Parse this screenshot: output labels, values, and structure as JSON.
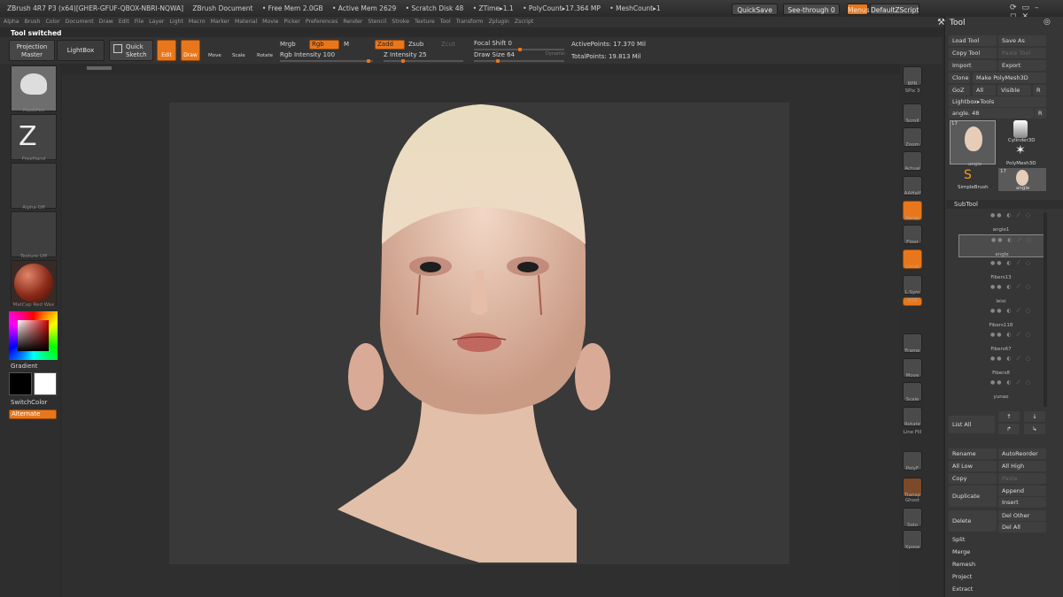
{
  "titlebar": {
    "app": "ZBrush 4R7 P3 (x64)[GHER-GFUF-QBOX-NBRI-NQWA]",
    "doc": "ZBrush Document",
    "free_mem": "• Free Mem 2.0GB",
    "active_mem": "• Active Mem 2629",
    "scratch": "• Scratch Disk 48",
    "ztime": "• ZTime▸1.1",
    "polycount": "• PolyCount▸17.364 MP",
    "meshcount": "• MeshCount▸1",
    "quicksave": "QuickSave",
    "seethrough": "See-through  0",
    "menus": "Menus",
    "script": "DefaultZScript"
  },
  "menus": [
    "Alpha",
    "Brush",
    "Color",
    "Document",
    "Draw",
    "Edit",
    "File",
    "Layer",
    "Light",
    "Macro",
    "Marker",
    "Material",
    "Movie",
    "Picker",
    "Preferences",
    "Render",
    "Stencil",
    "Stroke",
    "Texture",
    "Tool",
    "Transform",
    "Zplugin",
    "Zscript"
  ],
  "status": "Tool switched",
  "shelf": {
    "projection": "Projection Master",
    "lightbox": "LightBox",
    "quick": "Quick Sketch",
    "edit": "Edit",
    "draw": "Draw",
    "move": "Move",
    "scale": "Scale",
    "rotate": "Rotate",
    "mrgb": "Mrgb",
    "rgb": "Rgb",
    "m": "M",
    "zadd": "Zadd",
    "zsub": "Zsub",
    "zcut": "Zcut",
    "rgb_int": "Rgb Intensity 100",
    "z_int": "Z Intensity 25",
    "focal": "Focal Shift 0",
    "draw_size": "Draw Size 64",
    "dynamic": "Dynamic",
    "active_points": "ActivePoints: 17.370 Mil",
    "total_points": "TotalPoints: 19.813 Mil"
  },
  "left": {
    "brush_cap": "MaskPen",
    "stroke_cap": "FreeHand",
    "alpha_cap": "Alpha Off",
    "texture_cap": "Texture Off",
    "material_cap": "MatCap Red Wax",
    "gradient": "Gradient",
    "switchcolor": "SwitchColor",
    "alternate": "Alternate"
  },
  "right": [
    "BPR",
    "SPix 3",
    "Scroll",
    "Zoom",
    "Actual",
    "AAHalf",
    "Persp",
    "Floor",
    "Local",
    "L.Sym",
    "XYZ",
    "Frame",
    "Move",
    "Scale",
    "Rotate",
    "Line Fill",
    "PolyF",
    "Transp",
    "Ghost",
    "Solo",
    "Xpose"
  ],
  "tool": {
    "title": "Tool",
    "load": "Load Tool",
    "save": "Save As",
    "copy": "Copy Tool",
    "paste": "Paste Tool",
    "import": "Import",
    "export": "Export",
    "clone": "Clone",
    "polymesh": "Make PolyMesh3D",
    "goz": "GoZ",
    "all": "All",
    "visible": "Visible",
    "r": "R",
    "lightbox_tools": "Lightbox▸Tools",
    "angle": "angle. 48",
    "cur_cap": "angle",
    "cyl": "Cylinder3D",
    "poly": "PolyMesh3D",
    "simple": "SimpleBrush",
    "angle2": "angle",
    "count1": "17",
    "count2": "17"
  },
  "subtool": {
    "title": "SubTool",
    "items": [
      "angle1",
      "angle",
      "Fibers13",
      "leixi",
      "Fibers118",
      "Fibers67",
      "Fibers8",
      "yunao"
    ],
    "list_all": "List All"
  },
  "subtool_ops": {
    "rename": "Rename",
    "autoreorder": "AutoReorder",
    "alllow": "All Low",
    "allhigh": "All High",
    "copy": "Copy",
    "paste": "Paste",
    "duplicate": "Duplicate",
    "append": "Append",
    "insert": "Insert",
    "delete": "Delete",
    "delother": "Del Other",
    "delall": "Del All",
    "split": "Split",
    "merge": "Merge",
    "remesh": "Remesh",
    "project": "Project",
    "extract": "Extract"
  },
  "colors": {
    "accent": "#e8771c"
  }
}
